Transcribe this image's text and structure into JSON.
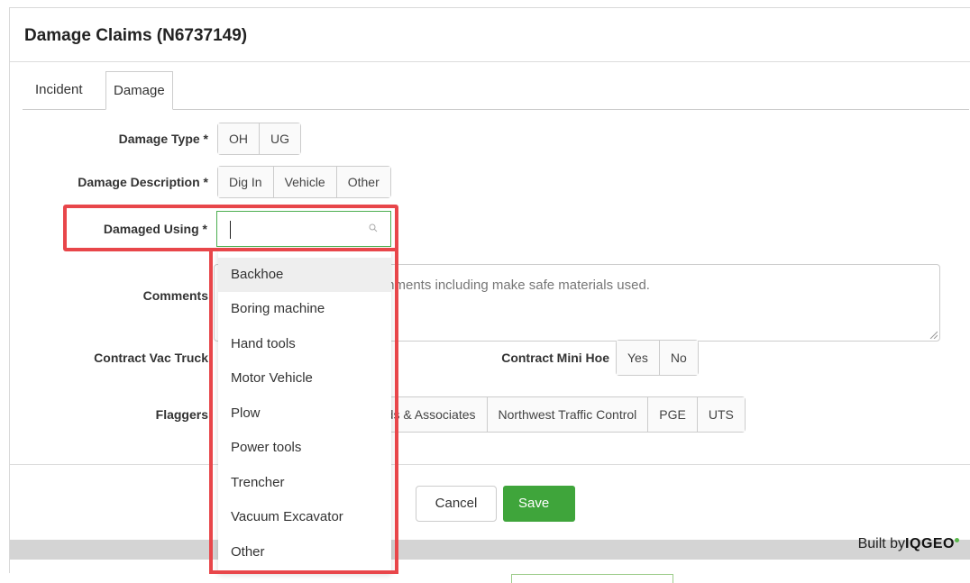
{
  "dialog": {
    "title": "Damage Claims (N6737149)"
  },
  "tabs": [
    {
      "label": "Incident"
    },
    {
      "label": "Damage"
    }
  ],
  "form": {
    "damage_type": {
      "label": "Damage Type *",
      "options": [
        "OH",
        "UG"
      ]
    },
    "damage_description": {
      "label": "Damage Description *",
      "options": [
        "Dig In",
        "Vehicle",
        "Other"
      ]
    },
    "damaged_using": {
      "label": "Damaged Using *",
      "value": ""
    },
    "comments": {
      "label": "Comments",
      "placeholder": "mments including make safe materials used."
    },
    "contract_vac_truck": {
      "label": "Contract Vac Truck"
    },
    "contract_mini_hoe": {
      "label": "Contract Mini Hoe",
      "options": [
        "Yes",
        "No"
      ]
    },
    "flaggers": {
      "label": "Flaggers",
      "options": [
        "rds & Associates",
        "Northwest Traffic Control",
        "PGE",
        "UTS"
      ]
    }
  },
  "dropdown": {
    "items": [
      "Backhoe",
      "Boring machine",
      "Hand tools",
      "Motor Vehicle",
      "Plow",
      "Power tools",
      "Trencher",
      "Vacuum Excavator",
      "Other"
    ],
    "highlighted": "Backhoe"
  },
  "footer": {
    "cancel_label": "Cancel",
    "save_label": "Save"
  },
  "branding": {
    "built_by": "Built by",
    "logo": "IQGEO"
  },
  "colors": {
    "save": "#3fa53b",
    "highlight": "#e8464a",
    "focus": "#4caf50"
  }
}
